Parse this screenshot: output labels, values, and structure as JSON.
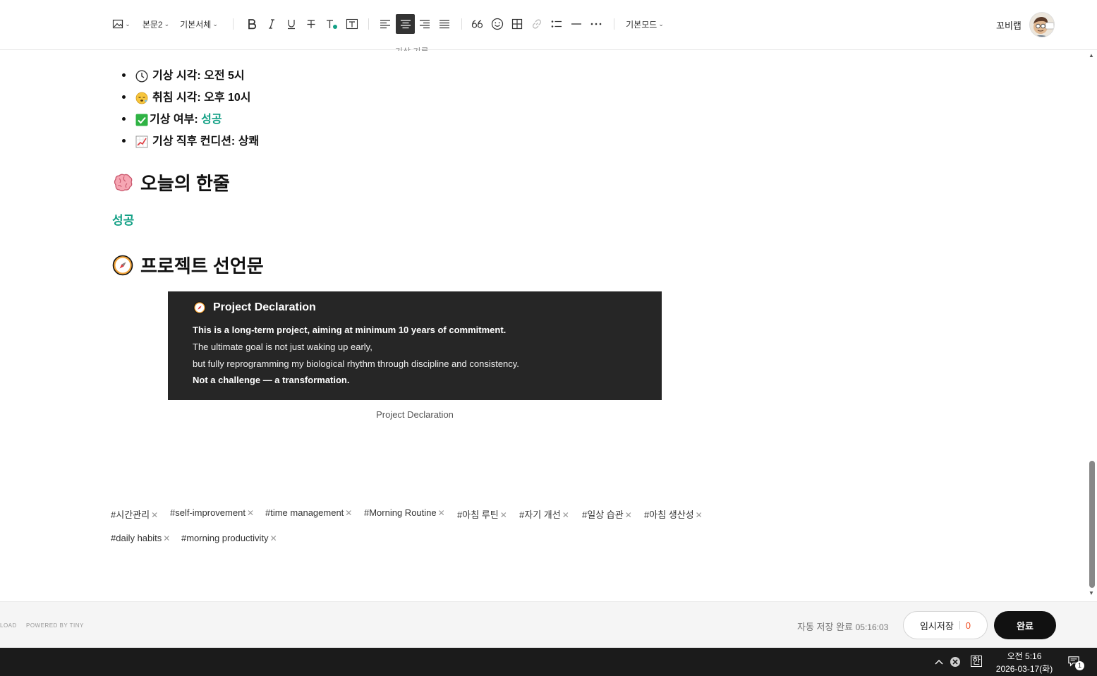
{
  "toolbar": {
    "paragraph_style": "본문2",
    "font_family": "기본서체",
    "mode": "기본모드",
    "profile_name": "꼬비랩"
  },
  "content": {
    "hidden_caption": "기상 기록",
    "stats": [
      {
        "label": "기상 시각: 오전 5시",
        "value": ""
      },
      {
        "label": "취침 시각: 오후 10시",
        "value": ""
      },
      {
        "label": "기상 여부: ",
        "value": "성공"
      },
      {
        "label": "기상 직후 컨디션: 상쾌",
        "value": ""
      }
    ],
    "section_today": "오늘의 한줄",
    "today_text": "성공",
    "section_declaration": "프로젝트 선언문",
    "declaration_image": {
      "title": "Project Declaration",
      "lines": [
        "This is a long-term project, aiming at minimum 10 years of commitment.",
        "The ultimate goal is not just waking up early,",
        "but fully reprogramming my biological rhythm through discipline and consistency.",
        "Not a challenge — a transformation."
      ]
    },
    "image_caption": "Project Declaration"
  },
  "tags": [
    "#시간관리",
    "#self-improvement",
    "#time management",
    "#Morning Routine",
    "#아침 루틴",
    "#자기 개선",
    "#일상 습관",
    "#아침 생산성",
    "#daily habits",
    "#morning productivity"
  ],
  "footer": {
    "load_text": "LOAD",
    "powered_by": "POWERED BY TINY",
    "autosave_label": "자동 저장 완료",
    "autosave_time": "05:16:03",
    "temp_save_label": "임시저장",
    "temp_save_count": "0",
    "done_label": "완료"
  },
  "taskbar": {
    "ime": "한",
    "time": "오전 5:16",
    "date": "2026-03-17(화)",
    "notification_count": "1"
  },
  "colors": {
    "accent_green": "#12a085",
    "dark_image_bg": "#262626",
    "temp_count": "#f04a1d"
  }
}
